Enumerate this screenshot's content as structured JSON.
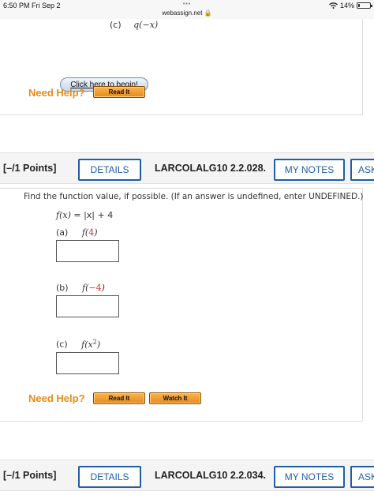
{
  "status_bar": {
    "time": "6:50 PM  Fri Sep 2",
    "dots": "•••",
    "url": "webassign.net 🔒",
    "battery": "14%",
    "battery_level": 0.14
  },
  "block_top": {
    "part_c_label": "(c)",
    "part_c_expr": "q(−x)",
    "begin_button": "Click here to begin!",
    "need_help": "Need Help?",
    "read_it": "Read It"
  },
  "header1": {
    "points": "[–/1 Points]",
    "details": "DETAILS",
    "code": "LARCOLALG10 2.2.028.",
    "my_notes": "MY NOTES",
    "ask": "ASK YOUR TEACHER"
  },
  "question": {
    "prompt": "Find the function value, if possible. (If an answer is undefined, enter UNDEFINED.)",
    "function_fx": "f(x)",
    "function_rhs": " = |x| + 4",
    "parts": [
      {
        "label": "(a)",
        "fn": "f(",
        "arg": "4",
        "close": ")",
        "value": ""
      },
      {
        "label": "(b)",
        "fn": "f(",
        "arg": "−4",
        "close": ")",
        "value": ""
      },
      {
        "label": "(c)",
        "fn": "f(x",
        "sup": "2",
        "close": ")",
        "value": ""
      }
    ],
    "need_help": "Need Help?",
    "read_it": "Read It",
    "watch_it": "Watch It"
  },
  "header2": {
    "points": "[–/1 Points]",
    "details": "DETAILS",
    "code": "LARCOLALG10 2.2.034.",
    "my_notes": "MY NOTES",
    "ask": "ASK YOUR TEACHER"
  }
}
